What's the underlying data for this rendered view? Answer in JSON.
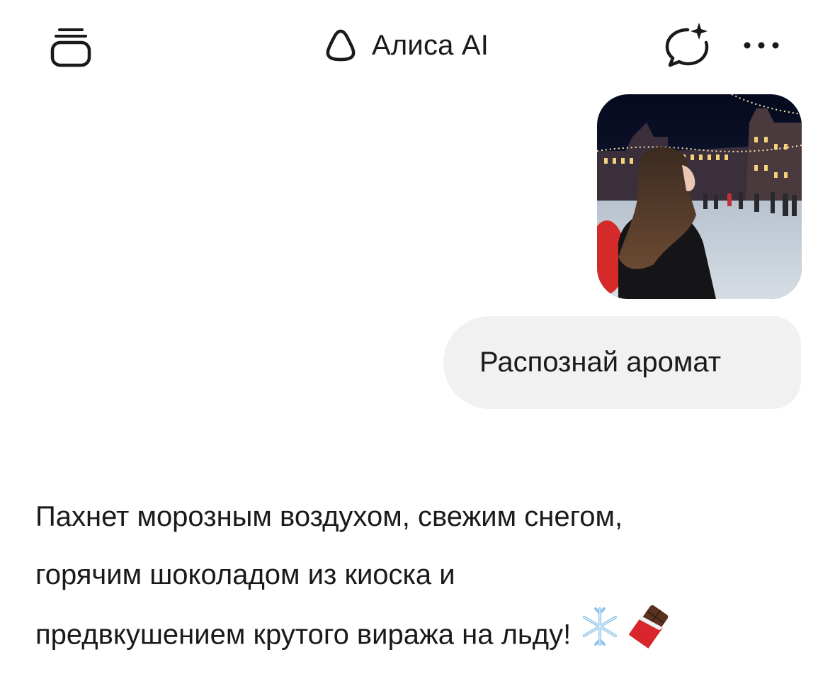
{
  "header": {
    "title": "Алиса AI",
    "icons": {
      "chats": "stacked-chats-icon",
      "logo": "alice-logo-icon",
      "new_chat": "new-chat-sparkle-icon",
      "more": "more-dots-icon"
    }
  },
  "conversation": {
    "user_photo": {
      "kind": "photo",
      "icon": "photo-thumbnail"
    },
    "user_message": "Распознай аромат",
    "assistant_reply": {
      "lines": [
        "Пахнет морозным воздухом, свежим снегом,",
        "горячим шоколадом из киоска и",
        "предвкушением крутого виража на льду!"
      ],
      "emojis": [
        "snowflake-icon",
        "chocolate-bar-icon"
      ]
    }
  },
  "colors": {
    "background": "#ffffff",
    "text": "#1a1a1a",
    "user_bubble": "#f1f1f1"
  }
}
